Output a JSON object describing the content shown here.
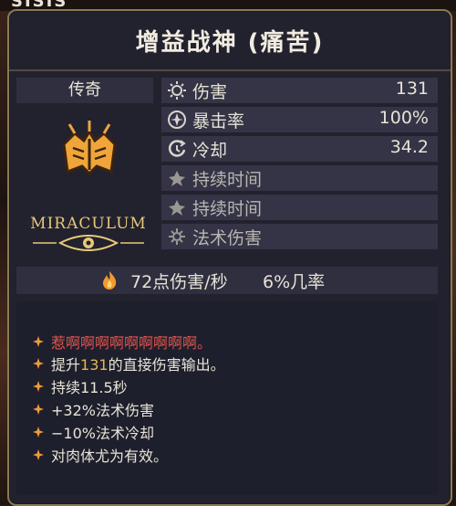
{
  "topbar": {
    "partial_text": "SISIS"
  },
  "item": {
    "title": "增益战神 (痛苦)",
    "rarity": "传奇",
    "icon": "golden-book-icon",
    "logo_text": "MIRACULUM"
  },
  "stats": [
    {
      "label": "伤害",
      "value": "131",
      "icon": "damage-sun-icon"
    },
    {
      "label": "暴击率",
      "value": "100%",
      "icon": "crit-rate-icon"
    },
    {
      "label": "冷却",
      "value": "34.2",
      "icon": "cooldown-icon"
    },
    {
      "label": "持续时间",
      "value": "",
      "icon": "duration-icon"
    },
    {
      "label": "持续时间",
      "value": "",
      "icon": "duration-icon"
    },
    {
      "label": "法术伤害",
      "value": "",
      "icon": "spell-damage-icon"
    }
  ],
  "dps": {
    "text": "72点伤害/秒",
    "chance": "6%几率",
    "icon": "flame-icon"
  },
  "description": [
    {
      "text": "惹啊啊啊啊啊啊啊啊啊。"
    },
    {
      "pre": "提升",
      "num": "131",
      "post": "的直接伤害输出。"
    },
    {
      "text": "持续11.5秒"
    },
    {
      "text": "+32%法术伤害"
    },
    {
      "text": "−10%法术冷却"
    },
    {
      "text": "对肉体尤为有效。"
    }
  ],
  "colors": {
    "panel_bg": "#22212e",
    "border": "#8a7a55",
    "gold": "#e7b84a",
    "red_text": "#e0554e",
    "orange_bullet": "#ef9a3a"
  }
}
